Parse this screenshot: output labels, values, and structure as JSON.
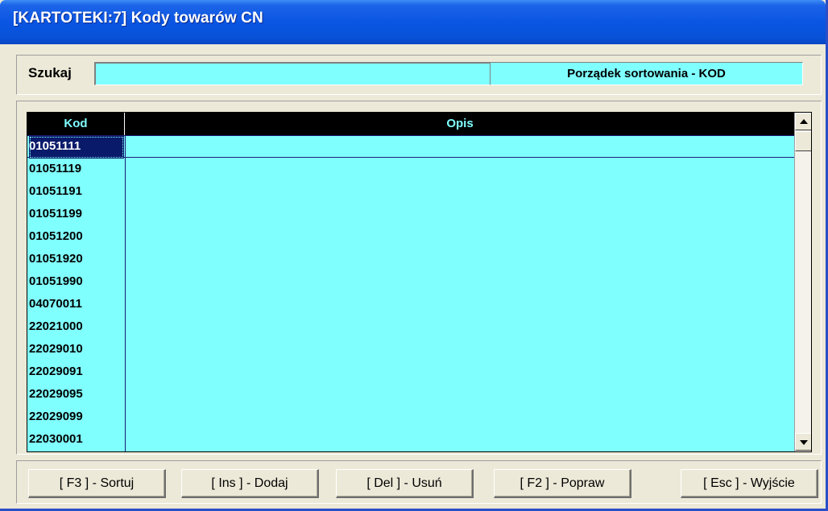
{
  "window": {
    "title": "[KARTOTEKI:7]  Kody towarów CN"
  },
  "search": {
    "label": "Szukaj",
    "value": "",
    "sort_order": "Porządek sortowania - KOD"
  },
  "grid": {
    "columns": {
      "kod": "Kod",
      "opis": "Opis"
    },
    "rows": [
      {
        "kod": "01051111",
        "opis": "",
        "selected": true
      },
      {
        "kod": "01051119",
        "opis": ""
      },
      {
        "kod": "01051191",
        "opis": ""
      },
      {
        "kod": "01051199",
        "opis": ""
      },
      {
        "kod": "01051200",
        "opis": ""
      },
      {
        "kod": "01051920",
        "opis": ""
      },
      {
        "kod": "01051990",
        "opis": ""
      },
      {
        "kod": "04070011",
        "opis": ""
      },
      {
        "kod": "22021000",
        "opis": ""
      },
      {
        "kod": "22029010",
        "opis": ""
      },
      {
        "kod": "22029091",
        "opis": ""
      },
      {
        "kod": "22029095",
        "opis": ""
      },
      {
        "kod": "22029099",
        "opis": ""
      },
      {
        "kod": "22030001",
        "opis": ""
      }
    ]
  },
  "buttons": {
    "sortuj": "[ F3 ] - Sortuj",
    "dodaj": "[ Ins ] - Dodaj",
    "usun": "[ Del ] - Usuń",
    "popraw": "[ F2 ] - Popraw",
    "wyjscie": "[ Esc ] - Wyjście"
  },
  "colors": {
    "titlebar": "#0a55e2",
    "field_background": "#80ffff",
    "header_background": "#000000",
    "selection": "#0a1a6a",
    "window_background": "#ece9d8"
  },
  "icons": {
    "scroll_up": "arrow-up-icon",
    "scroll_down": "arrow-down-icon"
  }
}
